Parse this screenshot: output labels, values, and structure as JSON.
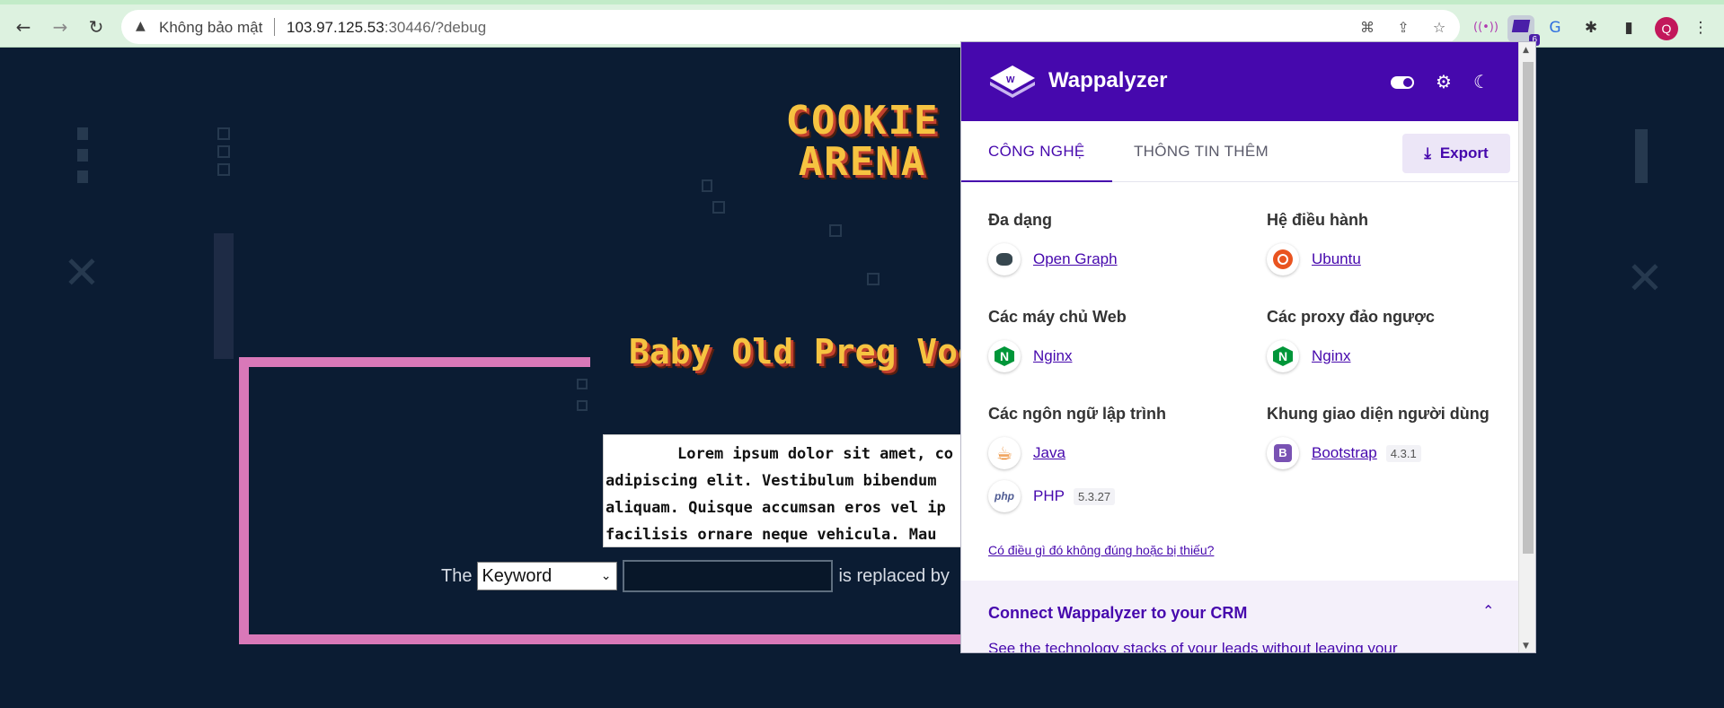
{
  "browser": {
    "security_label": "Không bảo mật",
    "url_host": "103.97.125.53",
    "url_rest": ":30446/?debug",
    "profile_initial": "Q",
    "extension_badge": "6"
  },
  "page": {
    "logo_line1": "COOKIE",
    "logo_line2": "ARENA",
    "game_title": "Baby Old Preg Voo",
    "lorem": "Lorem ipsum dolor sit amet, co adipiscing elit. Vestibulum bibendum aliquam. Quisque accumsan eros vel ip facilisis ornare neque vehicula. Mau",
    "form": {
      "prefix": "The",
      "select_value": "Keyword",
      "suffix": "is replaced by"
    }
  },
  "wappalyzer": {
    "brand": "Wappalyzer",
    "tabs": [
      "CÔNG NGHỆ",
      "THÔNG TIN THÊM"
    ],
    "export_label": "Export",
    "categories": [
      {
        "title": "Đa dạng",
        "techs": [
          {
            "name": "Open Graph",
            "version": ""
          }
        ]
      },
      {
        "title": "Hệ điều hành",
        "techs": [
          {
            "name": "Ubuntu",
            "version": ""
          }
        ]
      },
      {
        "title": "Các máy chủ Web",
        "techs": [
          {
            "name": "Nginx",
            "version": ""
          }
        ]
      },
      {
        "title": "Các proxy đảo ngược",
        "techs": [
          {
            "name": "Nginx",
            "version": ""
          }
        ]
      },
      {
        "title": "Các ngôn ngữ lập trình",
        "techs": [
          {
            "name": "Java",
            "version": ""
          },
          {
            "name": "PHP",
            "version": "5.3.27"
          }
        ]
      },
      {
        "title": "Khung giao diện người dùng",
        "techs": [
          {
            "name": "Bootstrap",
            "version": "4.3.1"
          }
        ]
      }
    ],
    "report_link": "Có điều gì đó không đúng hoặc bị thiếu?",
    "crm_title": "Connect Wappalyzer to your CRM",
    "crm_desc": "See the technology stacks of your leads without leaving your"
  },
  "colors": {
    "wappalyzer_purple": "#4608ad",
    "page_background": "#0b1c33",
    "frame_pink": "#d978b8",
    "logo_yellow": "#f6c341"
  }
}
